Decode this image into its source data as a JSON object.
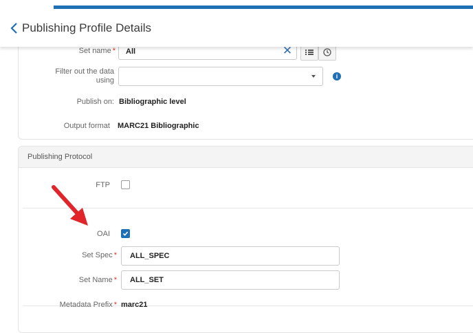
{
  "header": {
    "title": "Publishing Profile Details"
  },
  "form": {
    "set_name": {
      "label": "Set name",
      "value": "All"
    },
    "filter": {
      "label_line1": "Filter out the data",
      "label_line2": "using",
      "value": ""
    },
    "publish_on": {
      "label": "Publish on:",
      "value": "Bibliographic level"
    },
    "output_format": {
      "label": "Output format",
      "value": "MARC21 Bibliographic"
    }
  },
  "protocol": {
    "section_title": "Publishing Protocol",
    "ftp": {
      "label": "FTP",
      "checked": false
    },
    "oai": {
      "label": "OAI",
      "checked": true
    },
    "set_spec": {
      "label": "Set Spec",
      "value": "ALL_SPEC"
    },
    "set_name": {
      "label": "Set Name",
      "value": "ALL_SET"
    },
    "metadata_prefix": {
      "label": "Metadata Prefix",
      "value": "marc21"
    }
  },
  "required_marker": "*",
  "colors": {
    "accent": "#1f6fb5",
    "required": "#d9342b",
    "arrow": "#e0252b"
  },
  "icons": [
    "chevron-left-icon",
    "clear-icon",
    "list-icon",
    "history-icon",
    "caret-down-icon",
    "info-icon",
    "checkbox-icon",
    "red-arrow"
  ]
}
